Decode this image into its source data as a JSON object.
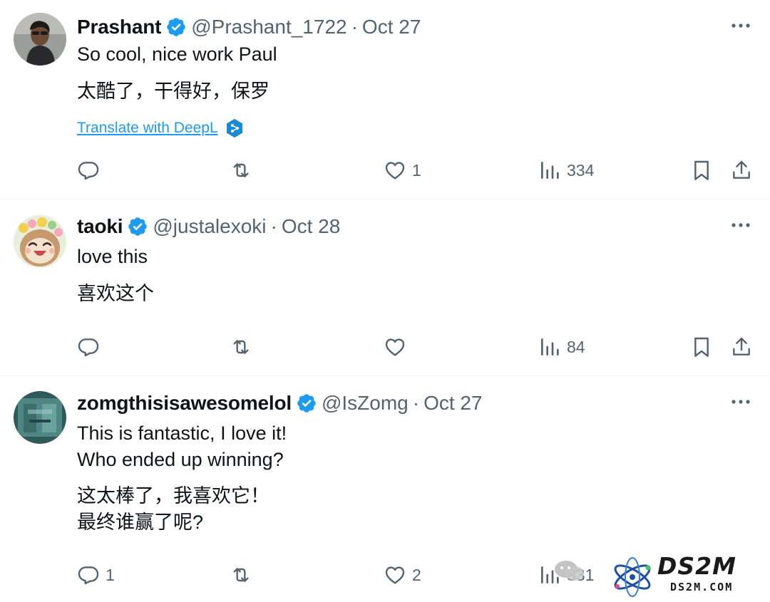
{
  "tweets": [
    {
      "display_name": "Prashant",
      "handle": "@Prashant_1722",
      "separator": "·",
      "date": "Oct 27",
      "text": [
        "So cool, nice work Paul"
      ],
      "translation": [
        "太酷了，干得好，保罗"
      ],
      "translate_label": "Translate with DeepL",
      "actions": {
        "replies": "",
        "retweets": "",
        "likes": "1",
        "views": "334"
      }
    },
    {
      "display_name": "taoki",
      "handle": "@justalexoki",
      "separator": "·",
      "date": "Oct 28",
      "text": [
        "love this"
      ],
      "translation": [
        "喜欢这个"
      ],
      "actions": {
        "replies": "",
        "retweets": "",
        "likes": "",
        "views": "84"
      }
    },
    {
      "display_name": "zomgthisisawesomelol",
      "handle": "@IsZomg",
      "separator": "·",
      "date": "Oct 27",
      "text": [
        "This is fantastic, I love it!",
        "Who ended up winning?"
      ],
      "translation": [
        "这太棒了，我喜欢它！",
        "最终谁赢了呢?"
      ],
      "actions": {
        "replies": "1",
        "retweets": "",
        "likes": "2",
        "views": "831"
      }
    }
  ],
  "icons": {
    "more": "more-horizontal-icon",
    "verified": "verified-badge-icon",
    "reply": "reply-icon",
    "retweet": "retweet-icon",
    "like": "heart-icon",
    "views": "analytics-icon",
    "bookmark": "bookmark-icon",
    "share": "share-icon",
    "deepl": "deepl-icon"
  },
  "colors": {
    "text": "#0f1419",
    "secondary": "#536471",
    "verified": "#1d9bf0",
    "link": "#1d9bf0",
    "divider": "#eff3f4"
  },
  "watermark": {
    "title": "DS2M",
    "subtitle": "DS2M.COM"
  }
}
